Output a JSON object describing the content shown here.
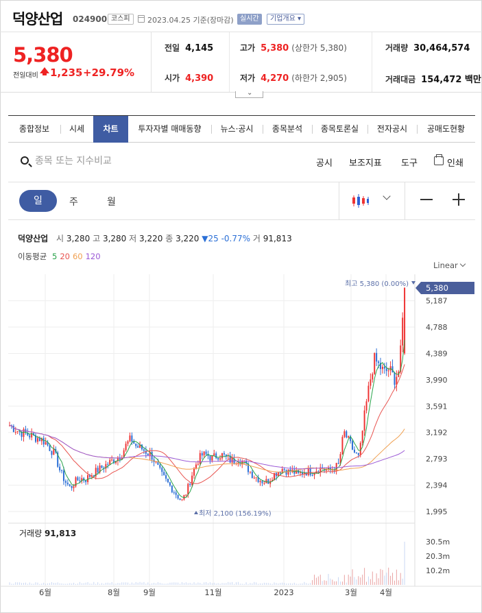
{
  "header": {
    "name": "덕양산업",
    "code": "024900",
    "market": "코스피",
    "date": "2023.04.25 기준(장마감)",
    "live": "실시간",
    "corp_info": "기업개요"
  },
  "price": {
    "current": "5,380",
    "vs_label": "전일대비",
    "change": "1,235",
    "pct": "+29.79%"
  },
  "stats": {
    "prev_label": "전일",
    "prev": "4,145",
    "open_label": "시가",
    "open": "4,390",
    "high_label": "고가",
    "high": "5,380",
    "high_sub": "(상한가 5,380)",
    "low_label": "저가",
    "low": "4,270",
    "low_sub": "(하한가 2,905)",
    "vol_label": "거래량",
    "vol": "30,464,574",
    "amt_label": "거래대금",
    "amt": "154,472 백만"
  },
  "tabs": [
    "종합정보",
    "시세",
    "차트",
    "투자자별 매매동향",
    "뉴스·공시",
    "종목분석",
    "종목토론실",
    "전자공시",
    "공매도현황"
  ],
  "active_tab": "차트",
  "toolbar": {
    "search_placeholder": "종목 또는 지수비교",
    "disclosure": "공시",
    "indicator": "보조지표",
    "tools": "도구",
    "print": "인쇄"
  },
  "periods": {
    "day": "일",
    "week": "주",
    "month": "월"
  },
  "legend": {
    "name": "덕양산업",
    "open_k": "시",
    "open": "3,280",
    "high_k": "고",
    "high": "3,280",
    "low_k": "저",
    "low": "3,220",
    "close_k": "종",
    "close": "3,220",
    "chg": "▼25 -0.77%",
    "vol_k": "거",
    "vol": "91,813",
    "ma_label": "이동평균",
    "ma": [
      "5",
      "20",
      "60",
      "120"
    ],
    "ma_colors": [
      "#26a248",
      "#e8534f",
      "#f0a050",
      "#9b59d6"
    ]
  },
  "scale_label": "Linear",
  "chart_data": {
    "type": "candlestick",
    "y_ticks": [
      "5,187",
      "4,788",
      "4,389",
      "3,990",
      "3,591",
      "3,192",
      "2,793",
      "2,394",
      "1,995"
    ],
    "y_values": [
      5187,
      4788,
      4389,
      3990,
      3591,
      3192,
      2793,
      2394,
      1995
    ],
    "ylim": [
      1995,
      5380
    ],
    "last_price_label": "5,380",
    "max_label": "최고 5,380 (0.00%)",
    "min_label": "최저 2,100 (156.19%)",
    "x_ticks": [
      "6월",
      "8월",
      "9월",
      "11월",
      "2023",
      "3월",
      "4월"
    ],
    "closes": [
      3300,
      3250,
      3200,
      3180,
      3150,
      3120,
      3100,
      3050,
      2950,
      2850,
      2600,
      2450,
      2350,
      2450,
      2500,
      2480,
      2550,
      2600,
      2650,
      2700,
      2750,
      2800,
      2850,
      3000,
      3100,
      2980,
      2950,
      2900,
      2850,
      2700,
      2550,
      2450,
      2350,
      2250,
      2150,
      2300,
      2550,
      2750,
      2850,
      2850,
      2800,
      2850,
      2850,
      2800,
      2750,
      2800,
      2750,
      2650,
      2550,
      2500,
      2450,
      2450,
      2550,
      2600,
      2650,
      2600,
      2600,
      2550,
      2600,
      2600,
      2600,
      2650,
      2650,
      2600,
      2650,
      2700,
      3200,
      3050,
      2900,
      2800,
      3400,
      3900,
      4300,
      4200,
      4100,
      4150,
      4000,
      4145,
      5380
    ],
    "volume": {
      "label": "거래량",
      "value": "91,813",
      "y_ticks": [
        "30.5m",
        "20.3m",
        "10.2m"
      ],
      "y_values": [
        30.5,
        20.3,
        10.2
      ]
    }
  }
}
